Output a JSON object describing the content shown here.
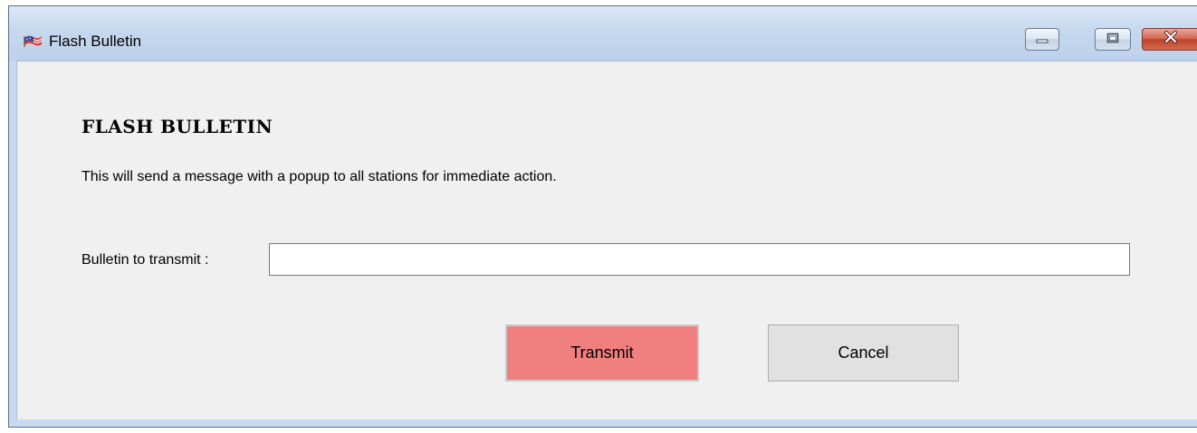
{
  "window": {
    "title": "Flash Bulletin",
    "icon": "flag-icon",
    "controls": {
      "minimize_icon": "minimize-icon",
      "maximize_icon": "maximize-icon",
      "close_icon": "close-icon"
    }
  },
  "content": {
    "heading": "FLASH BULLETIN",
    "description": "This will send a message with a popup to all stations for immediate action.",
    "bulletin_label": "Bulletin to transmit :",
    "bulletin_value": ""
  },
  "actions": {
    "transmit_label": "Transmit",
    "cancel_label": "Cancel"
  },
  "colors": {
    "transmit_bg": "#f08080",
    "client_bg": "#f0f0f0",
    "titlebar_bg": "#c6d8ee",
    "close_bg": "#c0412a"
  }
}
